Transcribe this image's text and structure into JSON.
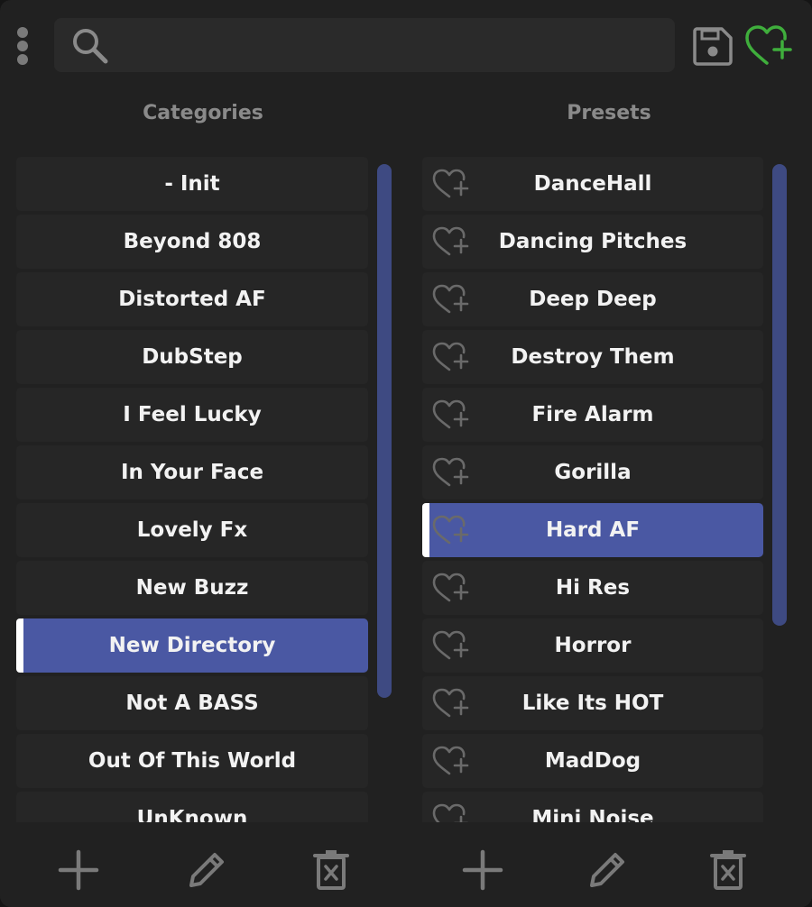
{
  "search": {
    "value": "",
    "placeholder": ""
  },
  "header": {
    "menu_icon": "vertical-dots-icon",
    "save_icon": "floppy-disk-icon",
    "favorite_icon": "heart-plus-icon"
  },
  "colors": {
    "accent_selected": "#4a58a3",
    "scroll_thumb": "#3e4a82",
    "favorite_green": "#3fae3c",
    "row_bg": "#262626",
    "app_bg": "#212121"
  },
  "categories": {
    "title": "Categories",
    "selected": "New Directory",
    "items": [
      {
        "label": "- Init"
      },
      {
        "label": "Beyond 808"
      },
      {
        "label": "Distorted AF"
      },
      {
        "label": "DubStep"
      },
      {
        "label": "I Feel Lucky"
      },
      {
        "label": "In Your Face"
      },
      {
        "label": "Lovely Fx"
      },
      {
        "label": "New Buzz"
      },
      {
        "label": "New Directory"
      },
      {
        "label": "Not A BASS"
      },
      {
        "label": "Out Of This World"
      },
      {
        "label": "UnKnown"
      }
    ]
  },
  "presets": {
    "title": "Presets",
    "selected": "Hard AF",
    "items": [
      {
        "label": "DanceHall"
      },
      {
        "label": "Dancing Pitches"
      },
      {
        "label": "Deep Deep"
      },
      {
        "label": "Destroy Them"
      },
      {
        "label": "Fire Alarm"
      },
      {
        "label": "Gorilla"
      },
      {
        "label": "Hard AF"
      },
      {
        "label": "Hi Res"
      },
      {
        "label": "Horror"
      },
      {
        "label": "Like Its HOT"
      },
      {
        "label": "MadDog"
      },
      {
        "label": "Mini Noise"
      }
    ]
  },
  "bottom": {
    "categories_actions": [
      "plus-icon",
      "pencil-icon",
      "trash-icon"
    ],
    "presets_actions": [
      "plus-icon",
      "pencil-icon",
      "trash-icon"
    ]
  }
}
